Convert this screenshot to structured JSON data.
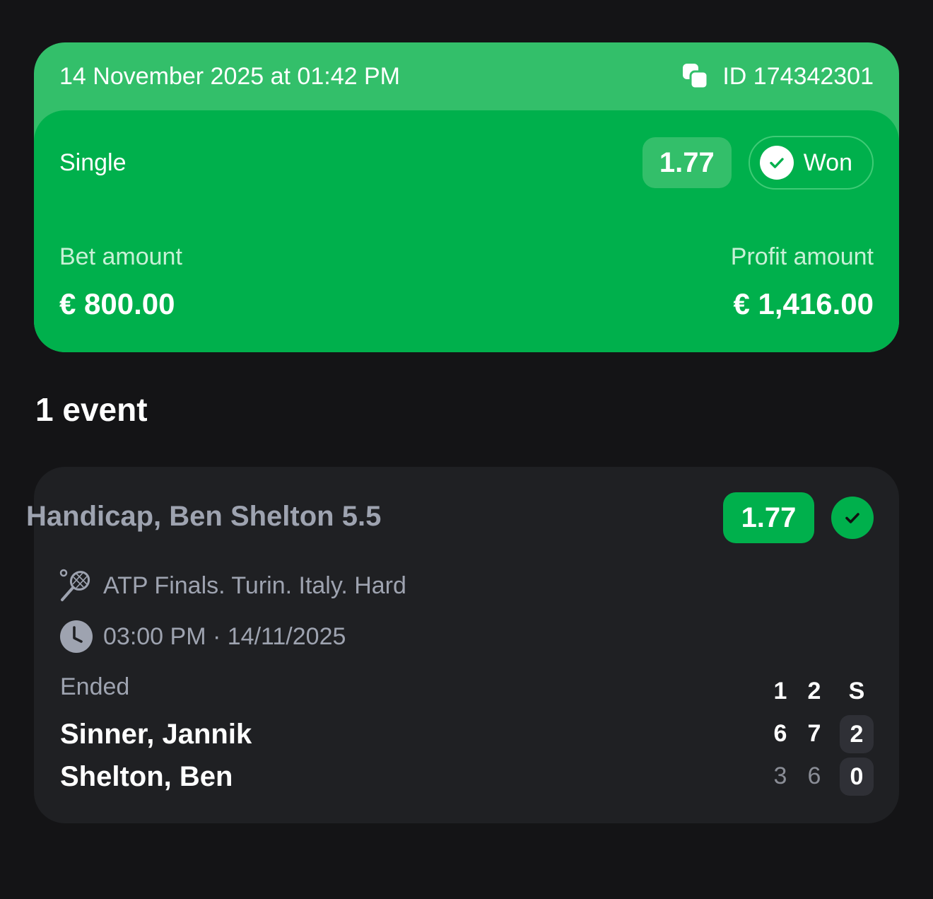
{
  "bet": {
    "datetime": "14 November 2025 at 01:42 PM",
    "id_label": "ID 174342301",
    "type": "Single",
    "odds": "1.77",
    "status": "Won",
    "bet_amount_label": "Bet amount",
    "bet_amount": "€ 800.00",
    "profit_amount_label": "Profit amount",
    "profit_amount": "€ 1,416.00"
  },
  "events_heading": "1 event",
  "event": {
    "market": "Handicap, Ben Shelton 5.5",
    "odds": "1.77",
    "tournament": "ATP Finals. Turin. Italy. Hard",
    "time": "03:00 PM · 14/11/2025",
    "status": "Ended",
    "score_columns": [
      "1",
      "2",
      "S"
    ],
    "players": [
      {
        "name": "Sinner, Jannik",
        "sets": [
          "6",
          "7"
        ],
        "total": "2"
      },
      {
        "name": "Shelton, Ben",
        "sets": [
          "3",
          "6"
        ],
        "total": "0"
      }
    ]
  },
  "icons": {
    "copy": "copy-icon",
    "won_check": "check-circle-icon",
    "sport": "tennis-racket-icon",
    "time": "clock-icon"
  },
  "colors": {
    "background": "#141416",
    "won_green": "#00b04c",
    "header_green": "#33bf6a",
    "card_bg": "#1f2023",
    "muted_text": "#9ea3b0"
  }
}
